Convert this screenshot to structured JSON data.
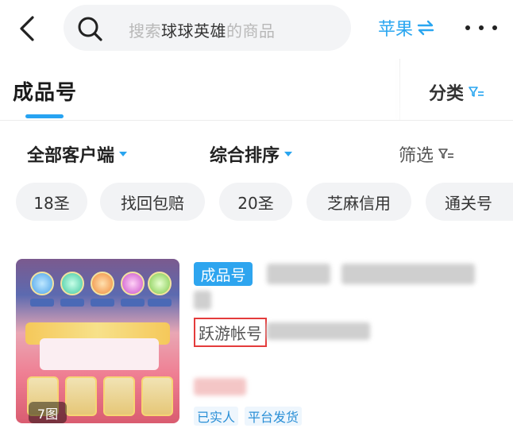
{
  "header": {
    "search": {
      "prefix": "搜索",
      "keyword": "球球英雄",
      "suffix": "的商品"
    },
    "platform_label": "苹果"
  },
  "tabs": {
    "main_label": "成品号",
    "category_label": "分类"
  },
  "filters": {
    "client_label": "全部客户端",
    "sort_label": "综合排序",
    "filter_label": "筛选"
  },
  "chips": [
    "18圣",
    "找回包赔",
    "20圣",
    "芝麻信用",
    "通关号"
  ],
  "listing": {
    "type_badge": "成品号",
    "account_label": "跃游帐号",
    "image_count": "7图",
    "tags": [
      "已实人",
      "平台发货"
    ]
  },
  "colors": {
    "accent": "#27a3f2",
    "highlight_border": "#e43c3c"
  }
}
